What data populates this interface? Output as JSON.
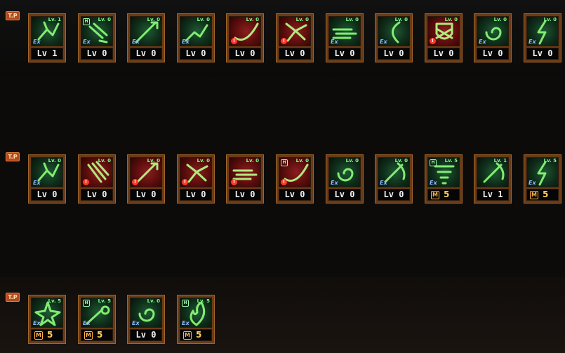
{
  "rows": [
    {
      "badge": "T.P",
      "skills": [
        {
          "icon": "kick-icon",
          "color": "green",
          "lv_tag": "Lv. 1",
          "ex": true,
          "excl": false,
          "h": false,
          "bottom": "Lv 1"
        },
        {
          "icon": "fist-icon",
          "color": "green",
          "lv_tag": "Lv. 0",
          "ex": true,
          "excl": false,
          "h": true,
          "bottom": "Lv 0"
        },
        {
          "icon": "spear-icon",
          "color": "green",
          "lv_tag": "Lv. 0",
          "ex": true,
          "excl": false,
          "h": false,
          "bottom": "Lv 0"
        },
        {
          "icon": "strike-icon",
          "color": "green",
          "lv_tag": "Lv. 0",
          "ex": true,
          "excl": false,
          "h": false,
          "bottom": "Lv 0"
        },
        {
          "icon": "slash-icon",
          "color": "red",
          "lv_tag": "Lv. 0",
          "ex": false,
          "excl": true,
          "h": false,
          "bottom": "Lv 0"
        },
        {
          "icon": "burst-icon",
          "color": "red",
          "lv_tag": "Lv. 0",
          "ex": false,
          "excl": true,
          "h": false,
          "bottom": "Lv 0"
        },
        {
          "icon": "dash-icon",
          "color": "green",
          "lv_tag": "Lv. 0",
          "ex": true,
          "excl": false,
          "h": false,
          "bottom": "Lv 0"
        },
        {
          "icon": "crescent-icon",
          "color": "green",
          "lv_tag": "Lv. 0",
          "ex": true,
          "excl": false,
          "h": false,
          "bottom": "Lv 0"
        },
        {
          "icon": "shield-icon",
          "color": "red",
          "lv_tag": "Lv. 0",
          "ex": false,
          "excl": true,
          "h": false,
          "bottom": "Lv 0"
        },
        {
          "icon": "whirl-icon",
          "color": "green",
          "lv_tag": "Lv. 0",
          "ex": true,
          "excl": false,
          "h": false,
          "bottom": "Lv 0"
        },
        {
          "icon": "lightning-icon",
          "color": "green",
          "lv_tag": "Lv. 0",
          "ex": true,
          "excl": false,
          "h": false,
          "bottom": "Lv 0"
        }
      ]
    },
    {
      "badge": "T.P",
      "skills": [
        {
          "icon": "kick-icon",
          "color": "green",
          "lv_tag": "Lv. 0",
          "ex": true,
          "excl": false,
          "h": false,
          "bottom": "Lv 0"
        },
        {
          "icon": "claw-icon",
          "color": "red",
          "lv_tag": "Lv. 0",
          "ex": false,
          "excl": true,
          "h": false,
          "bottom": "Lv 0"
        },
        {
          "icon": "spear-icon",
          "color": "red",
          "lv_tag": "Lv. 0",
          "ex": false,
          "excl": true,
          "h": false,
          "bottom": "Lv 0"
        },
        {
          "icon": "burst-icon",
          "color": "red",
          "lv_tag": "Lv. 0",
          "ex": false,
          "excl": true,
          "h": false,
          "bottom": "Lv 0"
        },
        {
          "icon": "dash-icon",
          "color": "red",
          "lv_tag": "Lv. 0",
          "ex": false,
          "excl": true,
          "h": false,
          "bottom": "Lv 0"
        },
        {
          "icon": "slash-icon",
          "color": "red",
          "lv_tag": "Lv. 0",
          "ex": false,
          "excl": true,
          "h": true,
          "bottom": "Lv 0"
        },
        {
          "icon": "whirl-icon",
          "color": "green",
          "lv_tag": "Lv. 0",
          "ex": true,
          "excl": false,
          "h": false,
          "bottom": "Lv 0"
        },
        {
          "icon": "swing-icon",
          "color": "green",
          "lv_tag": "Lv. 0",
          "ex": true,
          "excl": false,
          "h": false,
          "bottom": "Lv 0"
        },
        {
          "icon": "tornado-icon",
          "color": "green",
          "lv_tag": "Lv. 5",
          "ex": true,
          "excl": false,
          "h": true,
          "mp": "5"
        },
        {
          "icon": "swing-icon",
          "color": "green",
          "lv_tag": "Lv. 1",
          "ex": false,
          "excl": false,
          "h": false,
          "bottom": "Lv 1"
        },
        {
          "icon": "lightning-icon",
          "color": "green",
          "lv_tag": "Lv. 5",
          "ex": true,
          "excl": false,
          "h": false,
          "mp": "5"
        }
      ]
    },
    {
      "badge": "T.P",
      "skills": [
        {
          "icon": "star-icon",
          "color": "green",
          "lv_tag": "Lv. 5",
          "ex": true,
          "excl": false,
          "h": false,
          "mp": "5"
        },
        {
          "icon": "comet-icon",
          "color": "green",
          "lv_tag": "Lv. 5",
          "ex": true,
          "excl": false,
          "h": true,
          "mp": "5"
        },
        {
          "icon": "whirl-icon",
          "color": "green",
          "lv_tag": "Lv. 0",
          "ex": true,
          "excl": false,
          "h": false,
          "bottom": "Lv 0"
        },
        {
          "icon": "flame-icon",
          "color": "green",
          "lv_tag": "Lv. 5",
          "ex": true,
          "excl": false,
          "h": true,
          "mp": "5"
        }
      ]
    }
  ],
  "labels": {
    "ex": "Ex",
    "excl": "!",
    "h": "H",
    "m": "M"
  }
}
